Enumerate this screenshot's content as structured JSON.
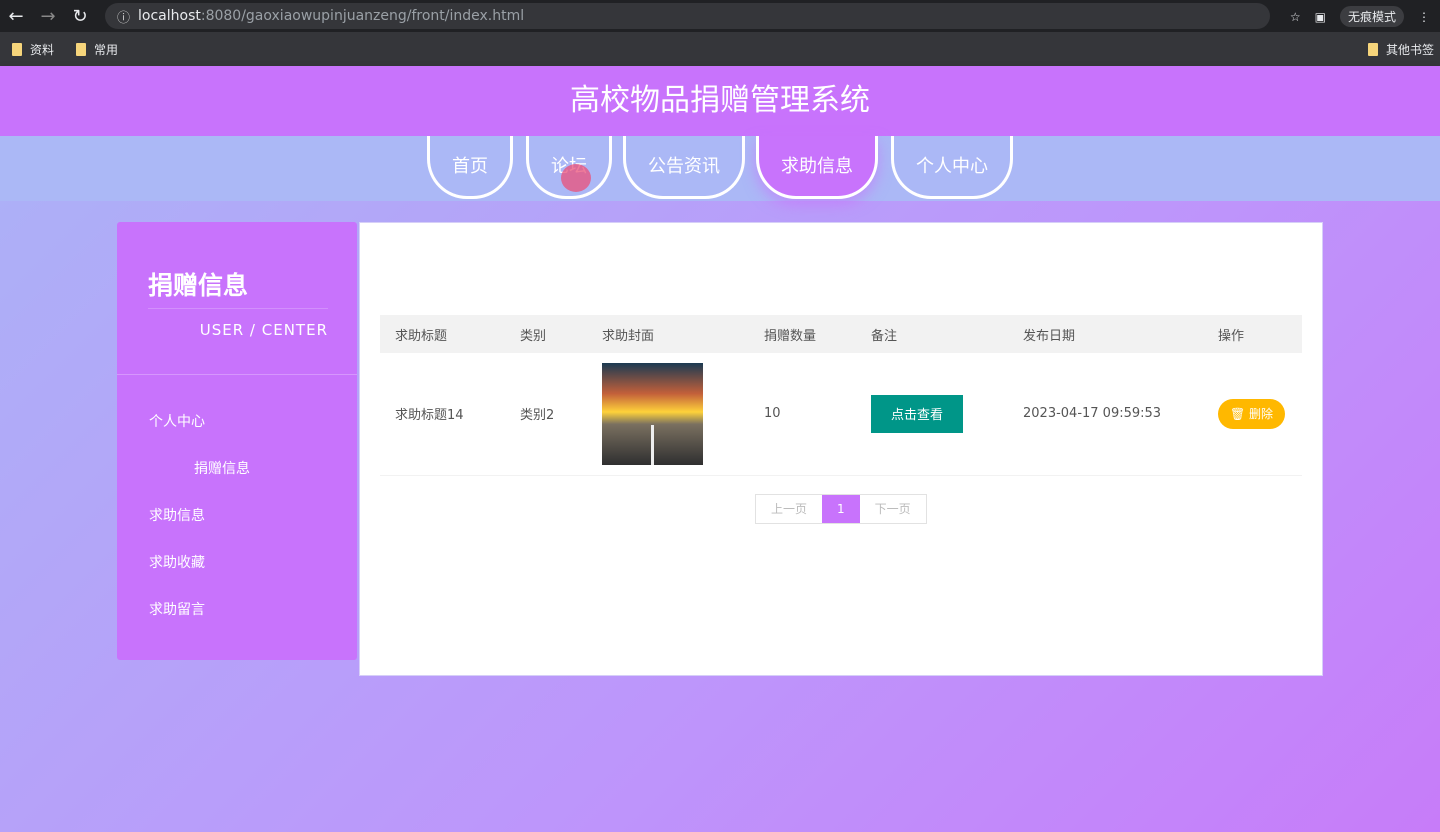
{
  "browser": {
    "url_host": "localhost",
    "url_rest": ":8080/gaoxiaowupinjuanzeng/front/index.html",
    "incognito_label": "无痕模式",
    "bookmarks": [
      "资料",
      "常用"
    ],
    "other_bookmarks": "其他书签"
  },
  "header": {
    "title": "高校物品捐赠管理系统"
  },
  "nav": {
    "tabs": [
      {
        "label": "首页"
      },
      {
        "label": "论坛"
      },
      {
        "label": "公告资讯"
      },
      {
        "label": "求助信息",
        "active": true
      },
      {
        "label": "个人中心"
      }
    ]
  },
  "sidebar": {
    "title": "捐赠信息",
    "subtitle": "USER / CENTER",
    "items": [
      {
        "label": "个人中心"
      },
      {
        "label": "捐赠信息"
      },
      {
        "label": "求助信息"
      },
      {
        "label": "求助收藏"
      },
      {
        "label": "求助留言"
      }
    ]
  },
  "table": {
    "headers": [
      "求助标题",
      "类别",
      "求助封面",
      "捐赠数量",
      "备注",
      "发布日期",
      "操作"
    ],
    "rows": [
      {
        "title": "求助标题14",
        "category": "类别2",
        "quantity": "10",
        "view_label": "点击查看",
        "date": "2023-04-17 09:59:53",
        "delete_label": "删除"
      }
    ]
  },
  "pager": {
    "prev": "上一页",
    "current": "1",
    "next": "下一页"
  },
  "colors": {
    "accent": "#c873fc",
    "view": "#009688",
    "delete": "#ffb800"
  }
}
